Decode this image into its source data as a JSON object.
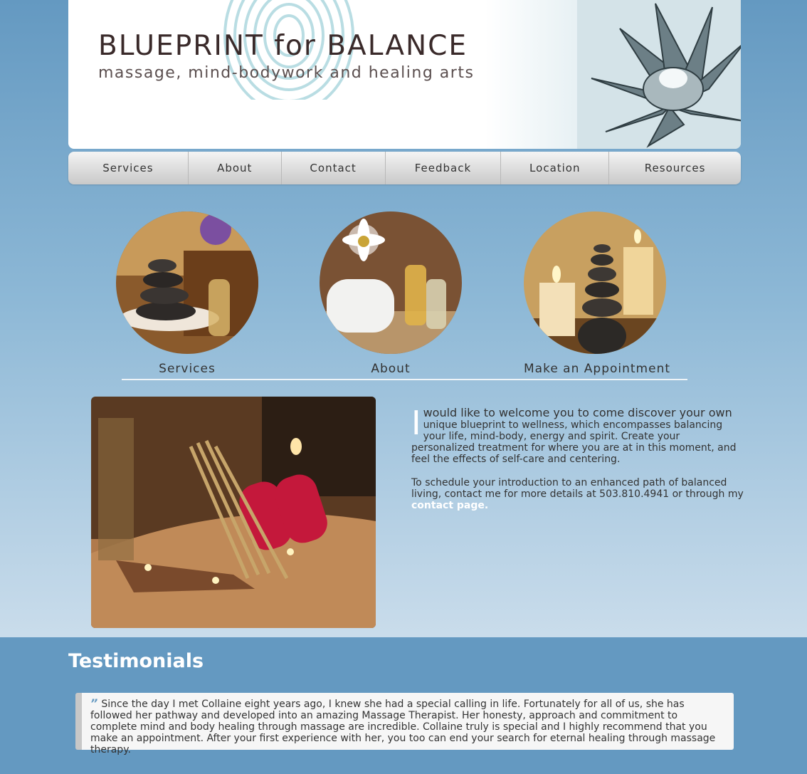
{
  "header": {
    "title": "BLUEPRINT for BALANCE",
    "tagline": "massage, mind-bodywork and healing arts"
  },
  "nav": {
    "items": [
      {
        "label": "Services"
      },
      {
        "label": "About"
      },
      {
        "label": "Contact"
      },
      {
        "label": "Feedback"
      },
      {
        "label": "Location"
      },
      {
        "label": "Resources"
      }
    ]
  },
  "features": [
    {
      "caption": "Services",
      "image": "stacked-stones-photo"
    },
    {
      "caption": "About",
      "image": "towel-daisy-oils-photo"
    },
    {
      "caption": "Make an Appointment",
      "image": "candles-stones-photo"
    }
  ],
  "welcome": {
    "drop_cap": "I",
    "lead": " would like to welcome you to come discover your own",
    "body": "unique blueprint to wellness, which encompasses balancing your life, mind-body, energy and spirit. Create your personalized treatment for where you are at in this moment, and feel the effects of self-care and centering.",
    "schedule_text": "To schedule your introduction to an enhanced path of balanced living, contact me for more details at 503.810.4941 or through my",
    "schedule_link": "contact page."
  },
  "testimonials": {
    "title": "Testimonials",
    "quote_mark": "”",
    "quote": "Since the day I met Collaine eight years ago, I knew she had a special calling in life. Fortunately for all of us, she has followed her pathway and developed into an amazing Massage Therapist. Her honesty, approach and commitment to complete mind and body healing through massage are incredible. Collaine truly is special and I highly recommend that you make an appointment. After your first experience with her, you too can end your search for eternal healing through massage therapy."
  },
  "colors": {
    "page_blue": "#6499c1",
    "link_white": "#ffffff",
    "text_dark": "#333333"
  }
}
